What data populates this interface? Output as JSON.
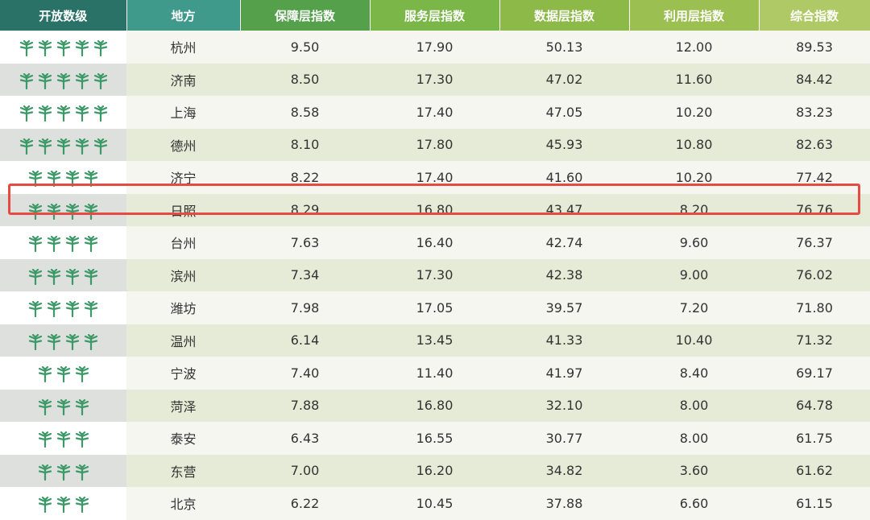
{
  "table": {
    "headers": [
      "开放数级",
      "地方",
      "保障层指数",
      "服务层指数",
      "数据层指数",
      "利用层指数",
      "综合指数"
    ],
    "level_icon": "tree-icon",
    "icon_color": "#3d9968",
    "highlight_color": "#e64a43",
    "rows": [
      {
        "level": 5,
        "city": "杭州",
        "baozhang": "9.50",
        "fuwu": "17.90",
        "shuju": "50.13",
        "liyong": "12.00",
        "zonghe": "89.53"
      },
      {
        "level": 5,
        "city": "济南",
        "baozhang": "8.50",
        "fuwu": "17.30",
        "shuju": "47.02",
        "liyong": "11.60",
        "zonghe": "84.42"
      },
      {
        "level": 5,
        "city": "上海",
        "baozhang": "8.58",
        "fuwu": "17.40",
        "shuju": "47.05",
        "liyong": "10.20",
        "zonghe": "83.23"
      },
      {
        "level": 5,
        "city": "德州",
        "baozhang": "8.10",
        "fuwu": "17.80",
        "shuju": "45.93",
        "liyong": "10.80",
        "zonghe": "82.63"
      },
      {
        "level": 4,
        "city": "济宁",
        "baozhang": "8.22",
        "fuwu": "17.40",
        "shuju": "41.60",
        "liyong": "10.20",
        "zonghe": "77.42"
      },
      {
        "level": 4,
        "city": "日照",
        "baozhang": "8.29",
        "fuwu": "16.80",
        "shuju": "43.47",
        "liyong": "8.20",
        "zonghe": "76.76",
        "highlighted": true
      },
      {
        "level": 4,
        "city": "台州",
        "baozhang": "7.63",
        "fuwu": "16.40",
        "shuju": "42.74",
        "liyong": "9.60",
        "zonghe": "76.37"
      },
      {
        "level": 4,
        "city": "滨州",
        "baozhang": "7.34",
        "fuwu": "17.30",
        "shuju": "42.38",
        "liyong": "9.00",
        "zonghe": "76.02"
      },
      {
        "level": 4,
        "city": "潍坊",
        "baozhang": "7.98",
        "fuwu": "17.05",
        "shuju": "39.57",
        "liyong": "7.20",
        "zonghe": "71.80"
      },
      {
        "level": 4,
        "city": "温州",
        "baozhang": "6.14",
        "fuwu": "13.45",
        "shuju": "41.33",
        "liyong": "10.40",
        "zonghe": "71.32"
      },
      {
        "level": 3,
        "city": "宁波",
        "baozhang": "7.40",
        "fuwu": "11.40",
        "shuju": "41.97",
        "liyong": "8.40",
        "zonghe": "69.17"
      },
      {
        "level": 3,
        "city": "菏泽",
        "baozhang": "7.88",
        "fuwu": "16.80",
        "shuju": "32.10",
        "liyong": "8.00",
        "zonghe": "64.78"
      },
      {
        "level": 3,
        "city": "泰安",
        "baozhang": "6.43",
        "fuwu": "16.55",
        "shuju": "30.77",
        "liyong": "8.00",
        "zonghe": "61.75"
      },
      {
        "level": 3,
        "city": "东营",
        "baozhang": "7.00",
        "fuwu": "16.20",
        "shuju": "34.82",
        "liyong": "3.60",
        "zonghe": "61.62"
      },
      {
        "level": 3,
        "city": "北京",
        "baozhang": "6.22",
        "fuwu": "10.45",
        "shuju": "37.88",
        "liyong": "6.60",
        "zonghe": "61.15"
      }
    ]
  }
}
